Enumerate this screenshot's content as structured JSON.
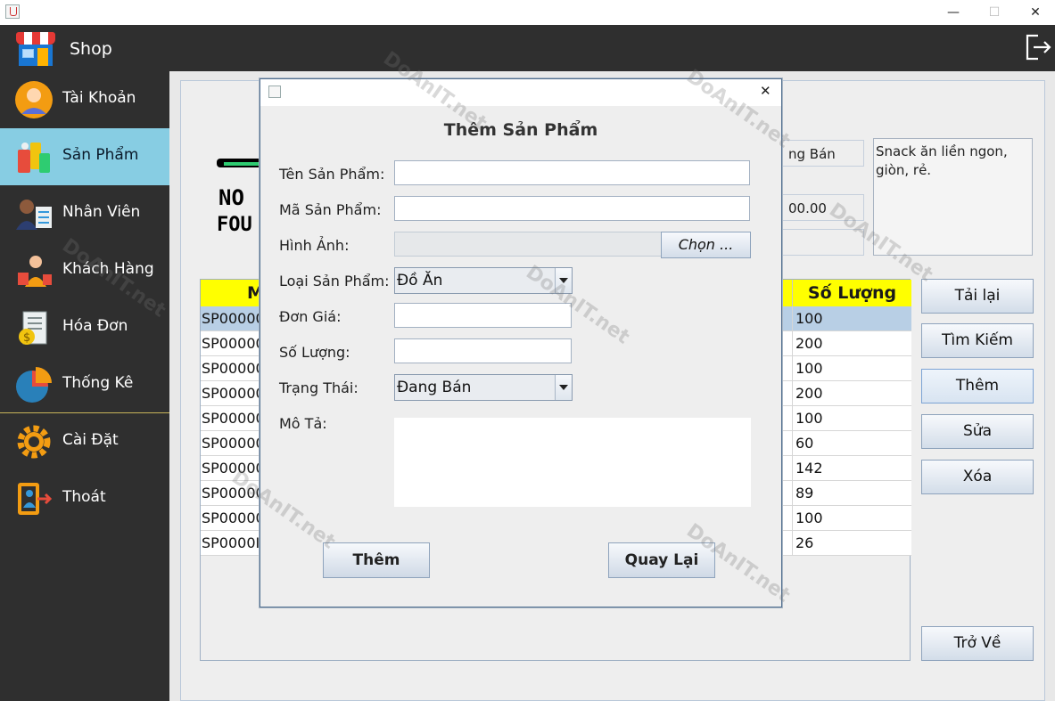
{
  "window": {
    "minimize": "—",
    "maximize": "☐",
    "close": "✕"
  },
  "app": {
    "title": "Shop"
  },
  "sidebar": {
    "items": [
      {
        "label": "Tài Khoản",
        "icon": "user-avatar-icon"
      },
      {
        "label": "Sản Phẩm",
        "icon": "products-icon"
      },
      {
        "label": "Nhân Viên",
        "icon": "employee-icon"
      },
      {
        "label": "Khách Hàng",
        "icon": "customer-icon"
      },
      {
        "label": "Hóa Đơn",
        "icon": "invoice-icon"
      },
      {
        "label": "Thống Kê",
        "icon": "pie-chart-icon"
      },
      {
        "label": "Cài Đặt",
        "icon": "settings-gear-icon"
      },
      {
        "label": "Thoát",
        "icon": "exit-icon"
      }
    ],
    "active": "Sản Phẩm"
  },
  "background": {
    "logo_line1": "NO",
    "logo_line2": "FOU",
    "status_partial": "ng Bán",
    "price_partial": "00.00",
    "description": "Snack ăn liền ngon, giòn, rẻ.",
    "table": {
      "col1_header": "M",
      "col2_header": "Số Lượng",
      "rows": [
        {
          "code": "SP00000",
          "qty": "100"
        },
        {
          "code": "SP00000",
          "qty": "200"
        },
        {
          "code": "SP00000",
          "qty": "100"
        },
        {
          "code": "SP00000",
          "qty": "200"
        },
        {
          "code": "SP00000",
          "qty": "100"
        },
        {
          "code": "SP00000",
          "qty": "60"
        },
        {
          "code": "SP00000",
          "qty": "142"
        },
        {
          "code": "SP00000",
          "qty": "89"
        },
        {
          "code": "SP00000",
          "qty": "100"
        },
        {
          "code": "SP0000I",
          "qty": "26"
        }
      ]
    },
    "buttons": {
      "reload": "Tải lại",
      "search": "Tìm Kiếm",
      "add": "Thêm",
      "edit": "Sửa",
      "delete": "Xóa",
      "back": "Trở Về"
    }
  },
  "dialog": {
    "close": "✕",
    "heading": "Thêm Sản Phẩm",
    "fields": {
      "name_label": "Tên Sản Phẩm:",
      "name_value": "",
      "code_label": "Mã Sản Phẩm:",
      "code_value": "",
      "image_label": "Hình Ảnh:",
      "image_value": "",
      "choose_button": "Chọn ...",
      "type_label": "Loại Sản Phẩm:",
      "type_value": "Đồ Ăn",
      "price_label": "Đơn Giá:",
      "price_value": "",
      "qty_label": "Số Lượng:",
      "qty_value": "",
      "status_label": "Trạng Thái:",
      "status_value": "Đang Bán",
      "desc_label": "Mô Tả:",
      "desc_value": ""
    },
    "buttons": {
      "add": "Thêm",
      "back": "Quay Lại"
    }
  },
  "watermark": "DoAnIT.net",
  "colors": {
    "sidebar_bg": "#2f2f2f",
    "sidebar_active": "#87cde3",
    "table_header": "#ffff00",
    "row_selected": "#b8cfe5"
  }
}
